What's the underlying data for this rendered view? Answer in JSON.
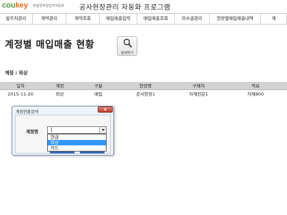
{
  "header": {
    "logo_co": "cou",
    "logo_key": "key",
    "logo_sub": "맞춤형엑셀업무자동화",
    "title": "공사현장관리 자동화 프로그램"
  },
  "nav": {
    "items": [
      {
        "label": "발주처관리",
        "width": 48
      },
      {
        "label": "계약관리",
        "width": 49
      },
      {
        "label": "계약조회",
        "width": 49
      },
      {
        "label": "매입매출입력",
        "width": 55
      },
      {
        "label": "매입매출조회",
        "width": 55
      },
      {
        "label": "미수금관리",
        "width": 51
      },
      {
        "label": "현장별매입매출내역",
        "width": 75
      },
      {
        "label": "계",
        "width": 38
      }
    ]
  },
  "page": {
    "title": "계정별 매입매출 현황",
    "search_label": "검색하기",
    "filter_text": "계정 : 외상"
  },
  "table": {
    "headers": [
      "일자",
      "계정",
      "구분",
      "현장명",
      "구매처",
      "적요"
    ],
    "rows": [
      [
        "2015-11-20",
        "외상",
        "매입",
        "공사현장1",
        "자재전문1",
        "자재800"
      ]
    ]
  },
  "dialog": {
    "title": "계정현황검색",
    "close_label": "x",
    "field_label": "계정명",
    "field_value": "|",
    "options": [
      {
        "label": "현금",
        "selected": false
      },
      {
        "label": "외상",
        "selected": true
      },
      {
        "label": "카드",
        "selected": false
      }
    ]
  },
  "colors": {
    "logo_green": "#4a9c3a",
    "logo_orange": "#e06a1a",
    "table_header_bg": "#d2d2d2",
    "selection_blue": "#3399ff",
    "close_button": "#c0392b"
  }
}
